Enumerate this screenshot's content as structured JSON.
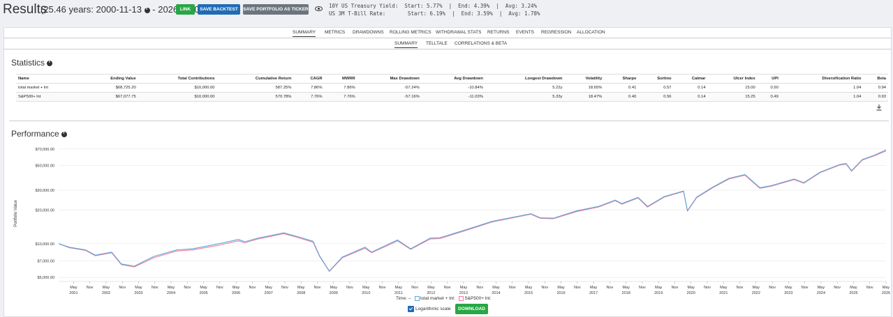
{
  "header": {
    "title": "Results",
    "range": "(25.46 years: 2000-11-13",
    "range_end": " - 2026-05-01)",
    "buttons": {
      "link": "LINK",
      "save_backtest": "SAVE BACKTEST",
      "save_ticker": "SAVE PORTFOLIO AS TICKER"
    },
    "treasury": "10Y US Treasury Yield:  Start: 5.77%  |  End: 4.39%  |  Avg: 3.24%",
    "tbill": "US 3M T-Bill Rate:       Start: 6.19%  |  End: 3.59%  |  Avg: 1.78%"
  },
  "tabs": [
    "SUMMARY",
    "METRICS",
    "DRAWDOWNS",
    "ROLLING METRICS",
    "WITHDRAWAL STATS",
    "RETURNS",
    "EVENTS",
    "REGRESSION",
    "ALLOCATION"
  ],
  "subtabs": [
    "SUMMARY",
    "TELLTALE",
    "CORRELATIONS & BETA"
  ],
  "statistics": {
    "title": "Statistics",
    "columns": [
      "Name",
      "Ending Value",
      "Total Contributions",
      "Cumulative Return",
      "CAGR",
      "MWRR",
      "Max Drawdown",
      "Avg Drawdown",
      "Longest Drawdown",
      "Volatility",
      "Sharpe",
      "Sortino",
      "Calmar",
      "Ulcer Index",
      "UPI",
      "Diversification Ratio",
      "Beta"
    ],
    "rows": [
      [
        "total market + lnt",
        "$68,725.20",
        "$10,000.00",
        "587.25%",
        "7.86%",
        "7.86%",
        "-57.24%",
        "-10.84%",
        "5.22y",
        "18.65%",
        "0.41",
        "0.57",
        "0.14",
        "15.00",
        "0.50",
        "1.04",
        "0.94"
      ],
      [
        "S&P500+ lnt",
        "$67,077.75",
        "$10,000.00",
        "570.78%",
        "7.76%",
        "7.76%",
        "-57.16%",
        "-11.03%",
        "5.33y",
        "18.47%",
        "0.40",
        "0.56",
        "0.14",
        "15.25",
        "0.49",
        "1.04",
        "0.93"
      ]
    ]
  },
  "performance": {
    "title": "Performance",
    "legend_time": "Time:",
    "legend_dash": "–",
    "logscale_label": "Logarithmic scale",
    "download_label": "DOWNLOAD"
  },
  "chart_data": {
    "type": "line",
    "title": "",
    "xlabel": "",
    "ylabel": "Portfolio Value",
    "yscale": "log",
    "ylim": [
      4600,
      75000
    ],
    "yticks": [
      "$5,000.00",
      "$7,000.00",
      "$10,000.00",
      "$20,000.00",
      "$30,000.00",
      "$50,000.00",
      "$70,000.00"
    ],
    "ytick_values": [
      5000,
      7000,
      10000,
      20000,
      30000,
      50000,
      70000
    ],
    "xticks": [
      [
        "May",
        "2001"
      ],
      [
        "Nov",
        ""
      ],
      [
        "May",
        "2002"
      ],
      [
        "Nov",
        ""
      ],
      [
        "May",
        "2003"
      ],
      [
        "Nov",
        ""
      ],
      [
        "May",
        "2004"
      ],
      [
        "Nov",
        ""
      ],
      [
        "May",
        "2005"
      ],
      [
        "Nov",
        ""
      ],
      [
        "May",
        "2006"
      ],
      [
        "Nov",
        ""
      ],
      [
        "May",
        "2007"
      ],
      [
        "Nov",
        ""
      ],
      [
        "May",
        "2008"
      ],
      [
        "Nov",
        ""
      ],
      [
        "May",
        "2009"
      ],
      [
        "Nov",
        ""
      ],
      [
        "May",
        "2010"
      ],
      [
        "Nov",
        ""
      ],
      [
        "May",
        "2011"
      ],
      [
        "Nov",
        ""
      ],
      [
        "May",
        "2012"
      ],
      [
        "Nov",
        ""
      ],
      [
        "May",
        "2013"
      ],
      [
        "Nov",
        ""
      ],
      [
        "May",
        "2014"
      ],
      [
        "Nov",
        ""
      ],
      [
        "May",
        "2015"
      ],
      [
        "Nov",
        ""
      ],
      [
        "May",
        "2016"
      ],
      [
        "Nov",
        ""
      ],
      [
        "May",
        "2017"
      ],
      [
        "Nov",
        ""
      ],
      [
        "May",
        "2018"
      ],
      [
        "Nov",
        ""
      ],
      [
        "May",
        "2019"
      ],
      [
        "Nov",
        ""
      ],
      [
        "May",
        "2020"
      ],
      [
        "Nov",
        ""
      ],
      [
        "May",
        "2021"
      ],
      [
        "Nov",
        ""
      ],
      [
        "May",
        "2022"
      ],
      [
        "Nov",
        ""
      ],
      [
        "May",
        "2023"
      ],
      [
        "Nov",
        ""
      ],
      [
        "May",
        "2024"
      ],
      [
        "Nov",
        ""
      ],
      [
        "May",
        "2025"
      ],
      [
        "Nov",
        ""
      ],
      [
        "May",
        "2026"
      ]
    ],
    "x": [
      2000.87,
      2001.2,
      2001.7,
      2002.0,
      2002.5,
      2002.8,
      2003.2,
      2003.8,
      2004.5,
      2005.0,
      2005.8,
      2006.4,
      2006.6,
      2007.0,
      2007.8,
      2008.3,
      2008.7,
      2008.9,
      2009.2,
      2009.6,
      2010.3,
      2010.5,
      2011.3,
      2011.7,
      2012.3,
      2012.6,
      2013.5,
      2014.2,
      2015.4,
      2015.7,
      2016.1,
      2016.8,
      2017.5,
      2018.0,
      2018.2,
      2018.7,
      2018.99,
      2019.5,
      2020.1,
      2020.22,
      2020.5,
      2021.0,
      2021.5,
      2021.99,
      2022.45,
      2022.8,
      2023.5,
      2023.8,
      2024.3,
      2024.9,
      2025.1,
      2025.27,
      2025.6,
      2026.0,
      2026.33
    ],
    "series": [
      {
        "name": "total market + lnt",
        "color": "#5aa9dc",
        "values": [
          10000,
          9300,
          8800,
          7900,
          8400,
          6600,
          6300,
          7700,
          8800,
          9000,
          10000,
          10900,
          10400,
          11200,
          12500,
          11400,
          10500,
          7800,
          5700,
          7600,
          9300,
          8400,
          10800,
          9000,
          11200,
          11300,
          13600,
          15800,
          18500,
          17000,
          16900,
          19600,
          21600,
          24500,
          22800,
          25900,
          21500,
          26300,
          29500,
          19700,
          26000,
          32000,
          38300,
          41400,
          31600,
          33000,
          37800,
          35000,
          43500,
          50800,
          52000,
          44800,
          56300,
          62000,
          68725
        ]
      },
      {
        "name": "S&P500+ lnt",
        "color": "#f07c9a",
        "values": [
          10000,
          9200,
          8700,
          7800,
          8300,
          6500,
          6200,
          7500,
          8600,
          8800,
          9700,
          10600,
          10200,
          11000,
          12300,
          11200,
          10300,
          7700,
          5650,
          7500,
          9100,
          8300,
          10600,
          8900,
          11000,
          11100,
          13400,
          15600,
          18300,
          16800,
          16700,
          19300,
          21300,
          24200,
          22500,
          25600,
          21200,
          26000,
          29200,
          19500,
          25700,
          31600,
          37800,
          40800,
          31200,
          32600,
          37300,
          34600,
          43000,
          50200,
          51400,
          44300,
          55600,
          61300,
          67078
        ]
      }
    ]
  }
}
